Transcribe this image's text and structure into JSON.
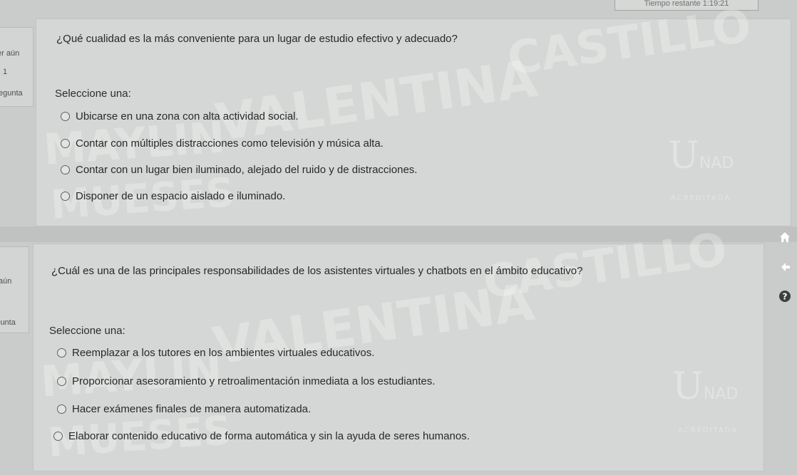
{
  "timer": {
    "label": "Tiempo restante 1:19:21"
  },
  "questions": [
    {
      "info": {
        "status": "er aún",
        "number": "1",
        "label": "egunta"
      },
      "text": "¿Qué cualidad es la más conveniente para un lugar de estudio efectivo y adecuado?",
      "prompt": "Seleccione una:",
      "options": [
        "Ubicarse en una zona con alta actividad social.",
        "Contar con múltiples distracciones como televisión y música alta.",
        "Contar con un lugar bien iluminado, alejado del ruido y de distracciones.",
        "Disponer de un espacio aislado e iluminado."
      ]
    },
    {
      "info": {
        "status": "aún",
        "label": "junta"
      },
      "text": "¿Cuál es una de las principales responsabilidades de los asistentes virtuales y chatbots en el ámbito educativo?",
      "prompt": "Seleccione una:",
      "options": [
        "Reemplazar a los tutores en los ambientes virtuales educativos.",
        "Proporcionar asesoramiento y retroalimentación inmediata a los estudiantes.",
        "Hacer exámenes finales de manera automatizada.",
        "Elaborar contenido educativo de forma automática y sin la ayuda de seres humanos."
      ]
    }
  ],
  "watermark": {
    "line1": "CASTILLO",
    "line2": "VALENTINA",
    "line3": "MAYLIN",
    "line4": "MUESES"
  },
  "logo": {
    "letter": "U",
    "rest": "NAD",
    "accreditation": "ACREDITADA"
  },
  "side_icons": [
    "home-icon",
    "arrow-left-icon",
    "help-icon"
  ]
}
